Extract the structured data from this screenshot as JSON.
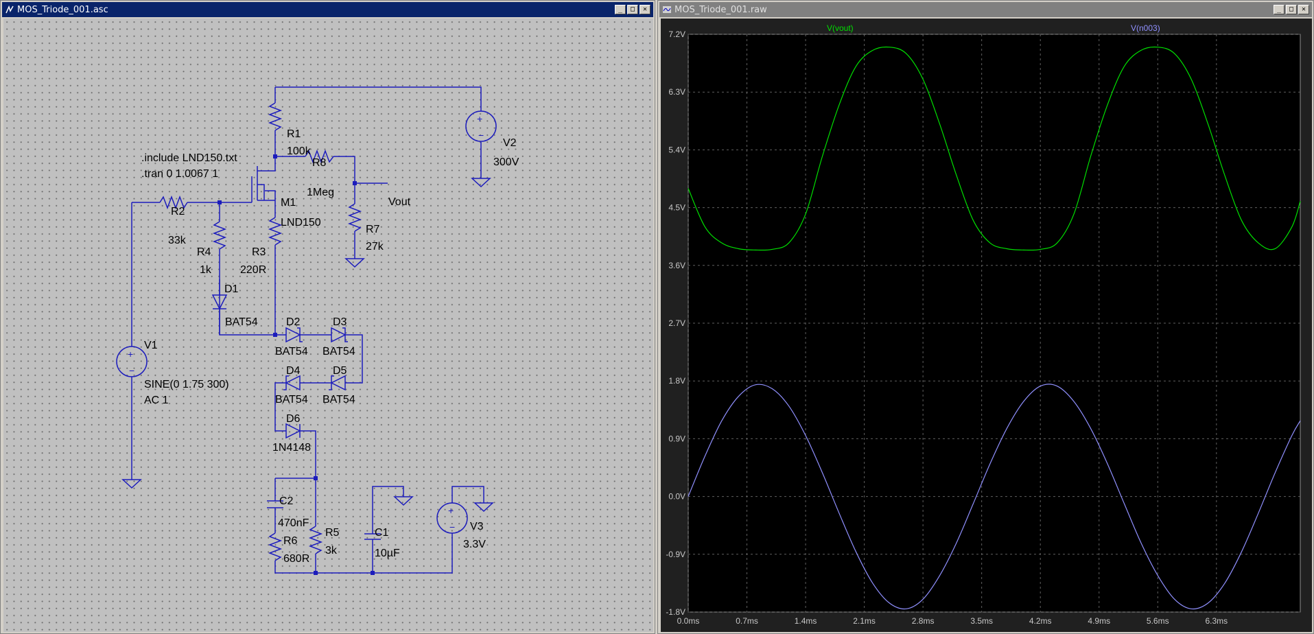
{
  "schematic_window": {
    "title": "MOS_Triode_001.asc",
    "buttons": {
      "minimize": "_",
      "maximize": "□",
      "close": "✕"
    },
    "directives": [
      ".include LND150.txt",
      ".tran 0 1.0067 1"
    ],
    "components": {
      "R1": {
        "name": "R1",
        "value": "100k"
      },
      "R2": {
        "name": "R2",
        "value": "33k"
      },
      "R3": {
        "name": "R3",
        "value": "220R"
      },
      "R4": {
        "name": "R4",
        "value": "1k"
      },
      "R5": {
        "name": "R5",
        "value": "3k"
      },
      "R6": {
        "name": "R6",
        "value": "680R"
      },
      "R7": {
        "name": "R7",
        "value": "27k"
      },
      "R8": {
        "name": "R8",
        "value": "1Meg"
      },
      "M1": {
        "name": "M1",
        "value": "LND150"
      },
      "D1": {
        "name": "D1",
        "value": "BAT54"
      },
      "D2": {
        "name": "D2",
        "value": "BAT54"
      },
      "D3": {
        "name": "D3",
        "value": "BAT54"
      },
      "D4": {
        "name": "D4",
        "value": "BAT54"
      },
      "D5": {
        "name": "D5",
        "value": "BAT54"
      },
      "D6": {
        "name": "D6",
        "value": "1N4148"
      },
      "C1": {
        "name": "C1",
        "value": "10µF"
      },
      "C2": {
        "name": "C2",
        "value": "470nF"
      },
      "V1": {
        "name": "V1",
        "value": "SINE(0 1.75 300)",
        "value2": "AC 1"
      },
      "V2": {
        "name": "V2",
        "value": "300V"
      },
      "V3": {
        "name": "V3",
        "value": "3.3V"
      }
    },
    "net_labels": {
      "vout": "Vout"
    }
  },
  "waveform_window": {
    "title": "MOS_Triode_001.raw",
    "buttons": {
      "minimize": "_",
      "maximize": "□",
      "close": "✕"
    },
    "trace_labels": [
      {
        "name": "V(vout)",
        "color": "#00e000"
      },
      {
        "name": "V(n003)",
        "color": "#9090ff"
      }
    ],
    "colors": {
      "background": "#000000",
      "grid": "#606060",
      "axis_text": "#c8c8c8"
    }
  },
  "chart_data": {
    "type": "line",
    "title": "",
    "xlabel": "",
    "ylabel": "",
    "x_ticks": [
      "0.0ms",
      "0.7ms",
      "1.4ms",
      "2.1ms",
      "2.8ms",
      "3.5ms",
      "4.2ms",
      "4.9ms",
      "5.6ms",
      "6.3ms"
    ],
    "y_ticks": [
      "7.2V",
      "6.3V",
      "5.4V",
      "4.5V",
      "3.6V",
      "2.7V",
      "1.8V",
      "0.9V",
      "0.0V",
      "-0.9V",
      "-1.8V"
    ],
    "xlim": [
      0,
      7.3
    ],
    "ylim": [
      -1.8,
      7.2
    ],
    "grid": true,
    "series": [
      {
        "name": "V(vout)",
        "color": "#00e000",
        "x": [
          0.0,
          0.2,
          0.4,
          0.6,
          0.8,
          1.0,
          1.2,
          1.4,
          1.6,
          1.8,
          2.0,
          2.2,
          2.4,
          2.6,
          2.8,
          3.0,
          3.2,
          3.4,
          3.6,
          3.8,
          4.0,
          4.2,
          4.4,
          4.6,
          4.8,
          5.0,
          5.2,
          5.4,
          5.6,
          5.8,
          6.0,
          6.2,
          6.4,
          6.6,
          6.8,
          7.0,
          7.2,
          7.3
        ],
        "values": [
          4.8,
          4.2,
          3.95,
          3.86,
          3.84,
          3.85,
          3.95,
          4.4,
          5.3,
          6.1,
          6.7,
          6.95,
          7.0,
          6.9,
          6.5,
          5.8,
          5.0,
          4.3,
          3.95,
          3.86,
          3.84,
          3.85,
          3.95,
          4.4,
          5.3,
          6.1,
          6.7,
          6.95,
          7.0,
          6.9,
          6.5,
          5.8,
          5.0,
          4.3,
          3.95,
          3.86,
          4.2,
          4.6
        ]
      },
      {
        "name": "V(n003)",
        "color": "#9090ff",
        "x": [
          0.0,
          0.2,
          0.4,
          0.6,
          0.8,
          1.0,
          1.2,
          1.4,
          1.6,
          1.8,
          2.0,
          2.2,
          2.4,
          2.6,
          2.8,
          3.0,
          3.2,
          3.4,
          3.6,
          3.8,
          4.0,
          4.2,
          4.4,
          4.6,
          4.8,
          5.0,
          5.2,
          5.4,
          5.6,
          5.8,
          6.0,
          6.2,
          6.4,
          6.6,
          6.8,
          7.0,
          7.2,
          7.3
        ],
        "values": [
          0.0,
          0.63,
          1.18,
          1.56,
          1.74,
          1.68,
          1.41,
          0.95,
          0.37,
          -0.26,
          -0.86,
          -1.35,
          -1.66,
          -1.75,
          -1.6,
          -1.23,
          -0.72,
          -0.11,
          0.51,
          1.06,
          1.48,
          1.72,
          1.72,
          1.48,
          1.06,
          0.51,
          -0.11,
          -0.72,
          -1.23,
          -1.6,
          -1.75,
          -1.66,
          -1.35,
          -0.86,
          -0.26,
          0.37,
          0.95,
          1.18
        ]
      }
    ]
  }
}
